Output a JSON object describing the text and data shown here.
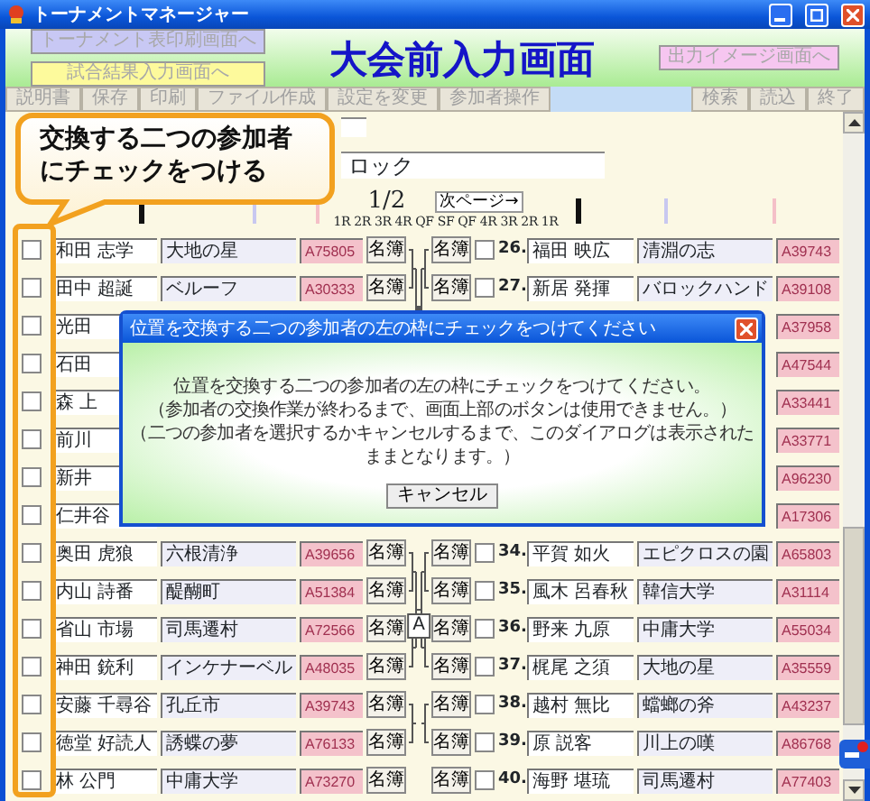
{
  "window": {
    "title": "トーナメントマネージャー"
  },
  "header": {
    "title": "大会前入力画面",
    "left_buttons": [
      {
        "label": "トーナメント表印刷画面へ",
        "color": "#c8c8f4",
        "disabled": true
      },
      {
        "label": "試合結果入力画面へ",
        "color": "#fdfa9c",
        "disabled": true
      }
    ],
    "right_buttons": [
      {
        "label": "出力イメージ画面へ",
        "color": "#f6c6f0",
        "disabled": true
      }
    ]
  },
  "toolbar": {
    "left": [
      {
        "label": "説明書",
        "disabled": true
      },
      {
        "label": "保存",
        "disabled": true
      },
      {
        "label": "印刷",
        "disabled": true
      },
      {
        "label": "ファイル作成",
        "disabled": true
      },
      {
        "label": "設定を変更",
        "disabled": true
      },
      {
        "label": "参加者操作",
        "disabled": true
      }
    ],
    "right": [
      {
        "label": "検索",
        "disabled": true
      },
      {
        "label": "読込",
        "disabled": true
      },
      {
        "label": "終了",
        "disabled": true
      }
    ]
  },
  "callout": {
    "text": "交換する二つの参加者にチェックをつける"
  },
  "name_field": {
    "value": "ロック"
  },
  "pager": {
    "page": "1/2",
    "next_button": "次ページ→",
    "rounds": "1R 2R 3R 4R QF SF QF 4R 3R 2R 1R"
  },
  "left_rows": [
    {
      "checked": false,
      "name": "和田 志学",
      "team": "大地の星",
      "id": "A75805",
      "roster": "名簿"
    },
    {
      "checked": false,
      "name": "田中 超誕",
      "team": "ベルーフ",
      "id": "A30333",
      "roster": "名簿"
    },
    {
      "checked": false,
      "name": "光田"
    },
    {
      "checked": false,
      "name": "石田"
    },
    {
      "checked": false,
      "name": "森 上"
    },
    {
      "checked": false,
      "name": "前川"
    },
    {
      "checked": false,
      "name": "新井"
    },
    {
      "checked": false,
      "name": "仁井谷"
    },
    {
      "checked": false,
      "name": "奥田 虎狼",
      "team": "六根清浄",
      "id": "A39656",
      "roster": "名簿"
    },
    {
      "checked": false,
      "name": "内山 詩番",
      "team": "醍醐町",
      "id": "A51384",
      "roster": "名簿"
    },
    {
      "checked": false,
      "name": "省山 市場",
      "team": "司馬遷村",
      "id": "A72566",
      "roster": "名簿"
    },
    {
      "checked": false,
      "name": "神田 銃利",
      "team": "インケナーベル",
      "id": "A48035",
      "roster": "名簿"
    },
    {
      "checked": false,
      "name": "安藤 千尋谷",
      "team": "孔丘市",
      "id": "A39743",
      "roster": "名簿"
    },
    {
      "checked": false,
      "name": "徳堂 好読人",
      "team": "誘蝶の夢",
      "id": "A76133",
      "roster": "名簿"
    },
    {
      "checked": false,
      "name": "林 公門",
      "team": "中庸大学",
      "id": "A73270",
      "roster": "名簿"
    }
  ],
  "right_rows": [
    {
      "roster": "名簿",
      "checked": false,
      "number": "26.",
      "name": "福田 映広",
      "team": "清淵の志",
      "id": "A39743"
    },
    {
      "roster": "名簿",
      "checked": false,
      "number": "27.",
      "name": "新居 発揮",
      "team": "バロックハンド",
      "id": "A39108"
    },
    {
      "id": "A37958"
    },
    {
      "id": "A47544"
    },
    {
      "id": "A33441"
    },
    {
      "id": "A33771"
    },
    {
      "id": "A96230"
    },
    {
      "id": "A17306"
    },
    {
      "roster": "名簿",
      "checked": false,
      "number": "34.",
      "name": "平賀 如火",
      "team": "エピクロスの園",
      "id": "A65803"
    },
    {
      "roster": "名簿",
      "checked": false,
      "number": "35.",
      "name": "風木 呂春秋",
      "team": "韓信大学",
      "id": "A31114"
    },
    {
      "roster": "名簿",
      "checked": false,
      "number": "36.",
      "name": "野来 九原",
      "team": "中庸大学",
      "id": "A55034"
    },
    {
      "roster": "名簿",
      "checked": false,
      "number": "37.",
      "name": "梶尾 之須",
      "team": "大地の星",
      "id": "A35559"
    },
    {
      "roster": "名簿",
      "checked": false,
      "number": "38.",
      "name": "越村 無比",
      "team": "蟷螂の斧",
      "id": "A43237"
    },
    {
      "roster": "名簿",
      "checked": false,
      "number": "39.",
      "name": "原 説客",
      "team": "川上の嘆",
      "id": "A86768"
    },
    {
      "roster": "名簿",
      "checked": false,
      "number": "40.",
      "name": "海野 堪琉",
      "team": "司馬遷村",
      "id": "A77403"
    }
  ],
  "block_label": "A",
  "dialog": {
    "title": "位置を交換する二つの参加者の左の枠にチェックをつけてください",
    "lines": [
      "位置を交換する二つの参加者の左の枠にチェックをつけてください。",
      "（参加者の交換作業が終わるまで、画面上部のボタンは使用できません。）",
      "（二つの参加者を選択するかキャンセルするまで、このダイアログは表示されたままとなります。）"
    ],
    "button": "キャンセル"
  }
}
